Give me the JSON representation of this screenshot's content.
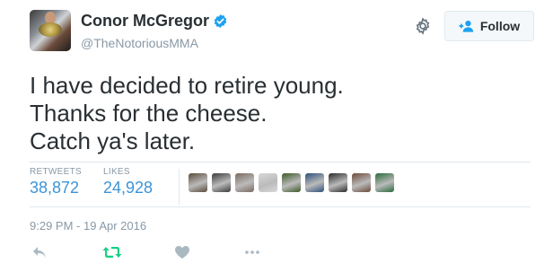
{
  "user": {
    "display_name": "Conor McGregor",
    "handle": "@TheNotoriousMMA",
    "verified": true
  },
  "follow_button": {
    "label": "Follow",
    "icon": "add-user-icon"
  },
  "tweet": {
    "lines": [
      "I have decided to retire young.",
      "Thanks for the cheese.",
      "Catch ya's later."
    ]
  },
  "stats": {
    "retweets_label": "RETWEETS",
    "retweets_value": "38,872",
    "likes_label": "LIKES",
    "likes_value": "24,928"
  },
  "likers": [
    {
      "color": "#5a4a3a"
    },
    {
      "color": "#3b3b3b"
    },
    {
      "color": "#7a6a60"
    },
    {
      "color": "#d8d8d8"
    },
    {
      "color": "#3d5a2a"
    },
    {
      "color": "#2f4f7a"
    },
    {
      "color": "#2a2a2a"
    },
    {
      "color": "#6b4a3a"
    },
    {
      "color": "#2a6a3a"
    }
  ],
  "timestamp": "9:29 PM - 19 Apr 2016",
  "colors": {
    "link_blue": "#3b94d9",
    "retweet_green": "#19cf86",
    "muted_gray": "#8899a6",
    "verified_blue": "#1da1f2"
  },
  "actions": [
    "reply-icon",
    "retweet-icon",
    "like-icon",
    "more-icon"
  ]
}
